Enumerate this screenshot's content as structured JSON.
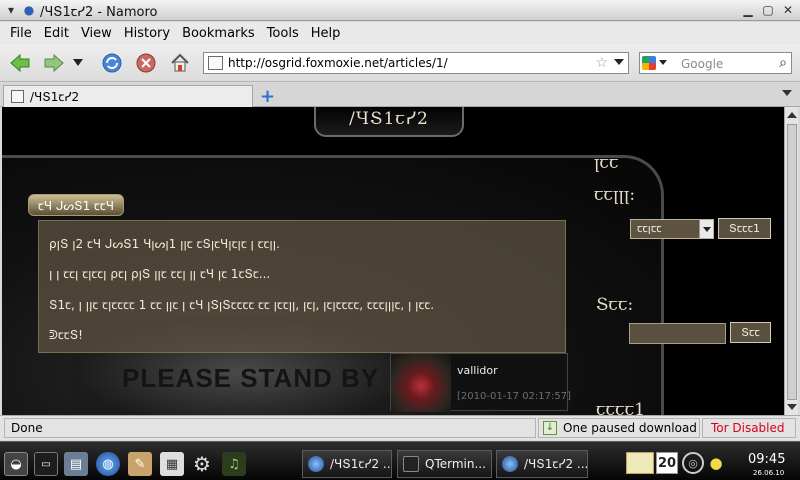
{
  "window": {
    "title": "/ꞍՏ1ꞇᓯ2 - Namoro"
  },
  "menu": [
    "File",
    "Edit",
    "View",
    "History",
    "Bookmarks",
    "Tools",
    "Help"
  ],
  "nav": {
    "url": "http://osgrid.foxmoxie.net/articles/1/",
    "search_placeholder": "Google"
  },
  "tab": {
    "title": "/ꞍՏ1ꞇᓯ2"
  },
  "page": {
    "header": "/ꞍՏ1ꞇᓯ2",
    "article_title": "ꞇꞍ ᒍᔕՏ1 ꞇꞇꞍ",
    "lines": [
      "ρꞁՏ ꞁ2 ꞇꞍ ᒍᔕՏ1 Ɥꞁᔕꞁ1 ꞁꞁꞇ ꞇՏꞁꞇꞍꞁꞇꞁꞇ ꞁ ꞇꞇꞁꞁ.",
      "ꞁ ꞁ ꞇꞇꞁ ꞇꞁꞇꞇꞁ ρꞇꞁ ρꞁՏ ꞁꞁꞇ ꞇꞇꞁ ꞁꞁ ꞇꞍ ꞁꞇ 1ꞇՏꞇ...",
      "Տ1ꞇ, ꞁ ꞁꞁꞇ ꞇꞁꞇꞇꞇꞇ 1 ꞇꞇ ꞁꞁꞇ ꞁ ꞇꞍ ꞁՏꞁՏꞇꞇꞇꞇ ꞇꞇ ꞁꞇꞇꞁꞁ, ꞁꞇꞁ, ꞁꞇꞁꞇꞇꞇꞇ, ꞇꞇꞇꞁꞁꞁꞇ, ꞁ ꞁꞇꞇ.",
      "ᕲꞇꞇՏ!"
    ],
    "standby_text": "PLEASE STAND BY",
    "comment": {
      "user": "vallidor",
      "time": "[2010-01-17 02:17:57]"
    },
    "sidebar": {
      "lang_heading_1": "ꞁꞇꞇ",
      "lang_heading_2": "ꞇꞇꞁꞁꞁ:",
      "lang_value": "ꞇꞇꞁꞇꞇ",
      "lang_button": "Տꞇꞇꞇ1",
      "search_heading": "Տꞇꞇ:",
      "search_button": "Տꞇꞇ",
      "bottom_heading": "ꞇꞇꞇꞇ1"
    }
  },
  "status": {
    "text": "Done",
    "download": "One paused download",
    "tor": "Tor Disabled"
  },
  "taskbar": {
    "tasks": [
      "/ꞍՏ1ꞇᓯ2 ...",
      "QTermin...",
      "/ꞍՏ1ꞇᓯ2 ..."
    ],
    "calendar_day": "20",
    "time": "09:45",
    "date": "26.06.10"
  },
  "colors": {
    "accent_tor": "#d9001b",
    "page_bg": "#000000",
    "gold_text": "#e5dcc4"
  }
}
